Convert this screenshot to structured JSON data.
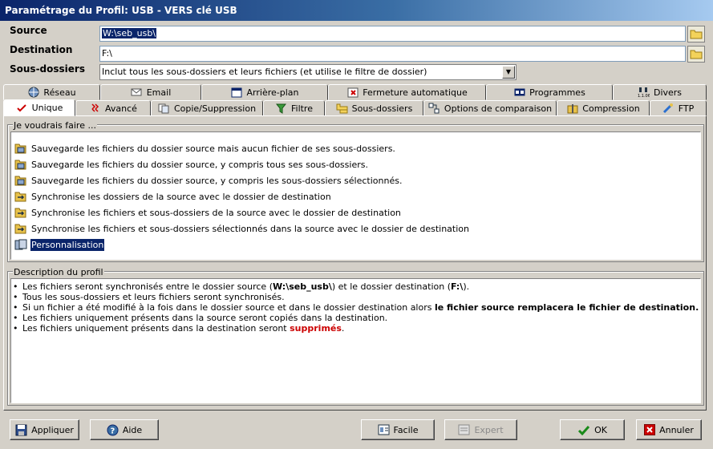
{
  "window": {
    "title": "Paramétrage du Profil: USB - VERS clé USB"
  },
  "form": {
    "source_label": "Source",
    "source_value": "W:\\seb_usb\\",
    "destination_label": "Destination",
    "destination_value": "F:\\",
    "subfolders_label": "Sous-dossiers",
    "subfolders_value": "Inclut tous les sous-dossiers et leurs fichiers (et utilise le filtre de dossier)"
  },
  "tabs_top": [
    {
      "label": "Réseau",
      "icon": "network-icon"
    },
    {
      "label": "Email",
      "icon": "email-icon"
    },
    {
      "label": "Arrière-plan",
      "icon": "window-icon"
    },
    {
      "label": "Fermeture automatique",
      "icon": "auto-close-icon"
    },
    {
      "label": "Programmes",
      "icon": "programs-icon"
    },
    {
      "label": "Divers",
      "icon": "misc-icon"
    }
  ],
  "tabs_bottom": [
    {
      "label": "Unique",
      "icon": "checkmark-icon",
      "active": true
    },
    {
      "label": "Avancé",
      "icon": "advanced-icon"
    },
    {
      "label": "Copie/Suppression",
      "icon": "copy-delete-icon"
    },
    {
      "label": "Filtre",
      "icon": "filter-icon"
    },
    {
      "label": "Sous-dossiers",
      "icon": "subfolders-icon"
    },
    {
      "label": "Options de comparaison",
      "icon": "compare-icon"
    },
    {
      "label": "Compression",
      "icon": "compression-icon"
    },
    {
      "label": "FTP",
      "icon": "ftp-icon"
    }
  ],
  "options_group": {
    "label": "Je voudrais faire ...",
    "items": [
      "Sauvegarde les fichiers du dossier source mais aucun fichier de ses sous-dossiers.",
      "Sauvegarde les fichiers du dossier source, y compris tous ses sous-dossiers.",
      "Sauvegarde les fichiers du dossier source, y compris les sous-dossiers sélectionnés.",
      "Synchronise les dossiers de la source avec le dossier de destination",
      "Synchronise les fichiers et sous-dossiers de la source avec le dossier de destination",
      "Synchronise les fichiers et sous-dossiers sélectionnés dans la source avec le dossier de destination",
      "Personnalisation"
    ],
    "selected_index": 6
  },
  "description": {
    "label": "Description du profil",
    "line1_a": "Les fichiers seront synchronisés entre le dossier source (",
    "line1_src": "W:\\seb_usb\\",
    "line1_b": ") et le dossier destination (",
    "line1_dst": "F:\\",
    "line1_c": ").",
    "line2": "Tous les sous-dossiers et leurs fichiers seront synchronisés.",
    "line3_a": "Si un fichier a été modifié à la fois dans le dossier source et dans le dossier destination alors ",
    "line3_b": "le fichier source remplacera le fichier de destination.",
    "line4": "Les fichiers uniquement présents dans la source seront copiés dans la destination.",
    "line5_a": "Les fichiers uniquement présents dans la destination seront ",
    "line5_b": "supprimés",
    "line5_c": "."
  },
  "buttons": {
    "apply": "Appliquer",
    "help": "Aide",
    "easy": "Facile",
    "expert": "Expert",
    "ok": "OK",
    "cancel": "Annuler"
  }
}
